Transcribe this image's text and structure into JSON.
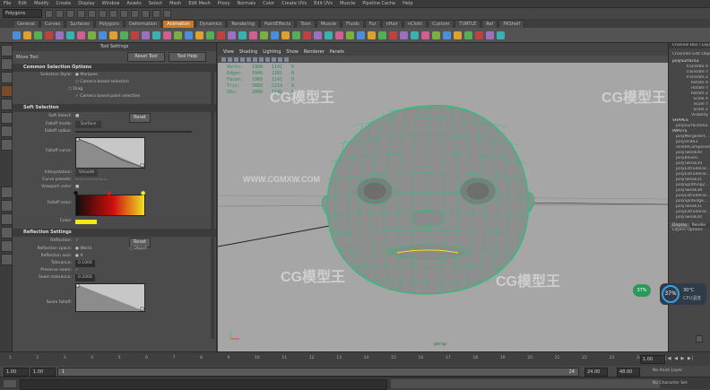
{
  "menubar": [
    "File",
    "Edit",
    "Modify",
    "Create",
    "Display",
    "Window",
    "Assets",
    "Select",
    "Mesh",
    "Edit Mesh",
    "Proxy",
    "Normals",
    "Color",
    "Create UVs",
    "Edit UVs",
    "Muscle",
    "Pipeline Cache",
    "Help"
  ],
  "status_line": {
    "mode": "Polygons"
  },
  "shelf_tabs": [
    "General",
    "Curves",
    "Surfaces",
    "Polygons",
    "Deformation",
    "Animation",
    "Dynamics",
    "Rendering",
    "PaintEffects",
    "Toon",
    "Muscle",
    "Fluids",
    "Fur",
    "nHair",
    "nCloth",
    "Custom",
    "TURTLE",
    "Ref",
    "PKShelf"
  ],
  "shelf_active_tab": "Animation",
  "tool_settings": {
    "window_title": "Tool Settings",
    "tool_name": "Move Tool",
    "reset_button": "Reset Tool",
    "help_button": "Tool Help",
    "sections": {
      "common": "Common Selection Options",
      "soft": "Soft Selection",
      "reflection": "Reflection Settings"
    },
    "common": {
      "selection_style_label": "Selection Style:",
      "selection_style_value": "Marquee",
      "camera_based": "Camera based selection",
      "drag_label": "Drag",
      "camera_paint": "Camera based paint selection"
    },
    "soft": {
      "soft_select_label": "Soft Select:",
      "reset": "Reset",
      "falloff_mode_label": "Falloff mode:",
      "falloff_mode_value": "Surface",
      "falloff_radius_label": "Falloff radius:",
      "falloff_curve_label": "Falloff curve:",
      "interpolation_label": "Interpolation:",
      "interpolation_value": "Smooth",
      "curve_presets_label": "Curve presets:",
      "viewport_color_label": "Viewport color:",
      "falloff_color_label": "Falloff color:",
      "color_label": "Color:"
    },
    "reflection": {
      "reflection_label": "Reflection:",
      "reset": "Reset",
      "reflection_space_label": "Reflection space:",
      "reflection_space_world": "World",
      "reflection_space_object": "Object",
      "reflection_axis_label": "Reflection axis:",
      "reflection_axis_value": "X",
      "tolerance_label": "Tolerance:",
      "tolerance_value": "0.1000",
      "preserve_seam_label": "Preserve seam:",
      "seam_tolerance_label": "Seam tolerance:",
      "seam_tolerance_value": "0.2000",
      "seam_falloff_label": "Seam falloff:"
    }
  },
  "viewport": {
    "menu": [
      "View",
      "Shading",
      "Lighting",
      "Show",
      "Renderer",
      "Panels"
    ],
    "hud_rows": [
      {
        "label": "Verts:",
        "a": "1980",
        "b": "1141",
        "c": "0"
      },
      {
        "label": "Edges:",
        "a": "3940",
        "b": "2281",
        "c": "0"
      },
      {
        "label": "Faces:",
        "a": "1960",
        "b": "1141",
        "c": "0"
      },
      {
        "label": "Tris:",
        "a": "3880",
        "b": "2214",
        "c": "0"
      },
      {
        "label": "UVs:",
        "a": "2000",
        "b": "1141",
        "c": "0"
      }
    ],
    "camera_label": "persp"
  },
  "channel_box": {
    "title": "Channel Box / Layer Editor",
    "menu": [
      "Channels",
      "Edit",
      "Object",
      "Show"
    ],
    "object_name": "polySurface3",
    "attrs": [
      "Translate X",
      "Translate Y",
      "Translate Z",
      "Rotate X",
      "Rotate Y",
      "Rotate Z",
      "Scale X",
      "Scale Y",
      "Scale Z",
      "Visibility"
    ],
    "shapes_header": "SHAPES",
    "shape_name": "polySurfaceSha...",
    "inputs_header": "INPUTS",
    "inputs": [
      "polyMergeVert...",
      "polyUnite3",
      "deleteComponen...",
      "polyTweak40",
      "polyBevel5",
      "polyTweak39",
      "polyExtrudeFac...",
      "polyExtrudeFac...",
      "polyTweak31",
      "polySplitRing2...",
      "polyTweak38",
      "polyExtrudeFac...",
      "polySplitEdge...",
      "polyTweak31",
      "polyExtrudeFac...",
      "polyTweak30"
    ],
    "tabs": [
      "Display",
      "Render",
      "Anim"
    ],
    "layers_menu": [
      "Layers",
      "Options"
    ]
  },
  "status_widgets": {
    "percent_a": "37%",
    "percent_b": "37%",
    "temp": "30°C",
    "cpu_label": "CPU温度"
  },
  "timeline": {
    "ticks": [
      "1",
      "2",
      "3",
      "4",
      "5",
      "6",
      "7",
      "8",
      "9",
      "10",
      "11",
      "12",
      "13",
      "14",
      "15",
      "16",
      "17",
      "18",
      "19",
      "20",
      "21",
      "22",
      "23",
      "24"
    ],
    "current_frame": "1.00",
    "start_value": "1.00",
    "range_start": "1.00",
    "range_field": "1",
    "range_end": "24",
    "end_a": "24.00",
    "end_b": "48.00",
    "anim_layer": "No Anim Layer",
    "char_set": "No Character Set"
  },
  "watermarks": [
    "CG模型王",
    "WWW.CGMXW.COM"
  ],
  "colors": {
    "mesh": "#27c07a",
    "accent_tab": "#c67a2a",
    "viewport_bg": "#a6a6a6"
  }
}
